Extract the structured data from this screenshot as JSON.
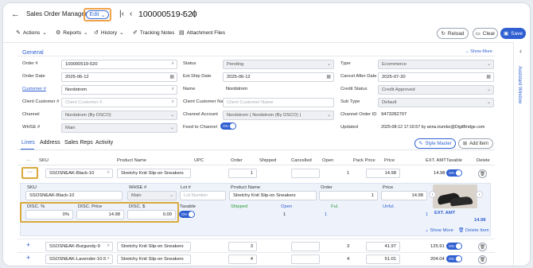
{
  "header": {
    "title": "Sales Order Management",
    "edit_label": "Edit",
    "order_number": "100000519-520"
  },
  "toolbar": {
    "actions": "Actions",
    "reports": "Reports",
    "history": "History",
    "tracking_notes": "Tracking Notes",
    "attachment_files": "Attachment Files",
    "reload": "Reload",
    "clear": "Clear",
    "save": "Save"
  },
  "side_rail": {
    "label": "Assistant Window"
  },
  "general": {
    "title": "General",
    "show_more": "Show More",
    "order_no_label": "Order #",
    "order_no": "100000519-520",
    "order_date_label": "Order Date",
    "order_date": "2025-06-12",
    "customer_label": "Customer #",
    "customer": "Nordstrom",
    "client_customer_label": "Client Customer #",
    "client_customer_ph": "Client Customer #",
    "channel_label": "Channel",
    "channel": "Nordstrom (By DSCO)",
    "whse_label": "WHSE #",
    "whse": "Main",
    "status_label": "Status",
    "status": "Pending",
    "est_ship_label": "Est.Ship Date",
    "est_ship": "2025-06-12",
    "name_label": "Name",
    "name": "Nordstrom",
    "client_customer_name_label": "Client Customer Name",
    "client_customer_name_ph": "Client Customer Name",
    "channel_account_label": "Channel Account",
    "channel_account": "Nordstrom ( Nordstrom (By DSCO) )",
    "feed_label": "Feed to Channel",
    "feed_toggle": "ON",
    "type_label": "Type",
    "type": "Ecommerce",
    "cancel_after_label": "Cancel After Date",
    "cancel_after": "2025-07-20",
    "credit_status_label": "Credit Status",
    "credit_status": "Credit Approved",
    "sub_type_label": "Sub Type",
    "sub_type": "Default",
    "channel_order_label": "Channel Order ID",
    "channel_order": "9473282707",
    "updated_label": "Updated",
    "updated": "2025-08-12 17:16:57 by anna.trumbo@DigitBridge.com"
  },
  "tabs": [
    "Lines",
    "Address",
    "Sales Reps",
    "Activity"
  ],
  "lines_actions": {
    "style_master": "Style Master",
    "add_item": "Add Item"
  },
  "table": {
    "headers": [
      "SKU",
      "Product Name",
      "UPC",
      "Order",
      "Shipped",
      "Cancelled",
      "Open",
      "Pack Price",
      "Price",
      "EXT. AMT",
      "Taxable",
      "Delete"
    ],
    "rows": [
      {
        "sku": "SSOSNEAK-Black-10",
        "name": "Stretchy Knit Slip-on Sneakers",
        "order": "1",
        "open": "1",
        "price": "14.98",
        "ext": "14.98",
        "taxable": "ON"
      },
      {
        "sku": "SSOSNEAK-Burgundy-9",
        "name": "Stretchy Knit Slip-on Sneakers",
        "order": "3",
        "open": "3",
        "price": "41.97",
        "ext": "125.91",
        "taxable": "ON"
      },
      {
        "sku": "SSOSNEAK-Lavender-10.5",
        "name": "Stretchy Knit Slip-on Sneakers",
        "order": "4",
        "open": "4",
        "price": "51.01",
        "ext": "204.04",
        "taxable": "ON"
      }
    ]
  },
  "detail": {
    "more_icon": "···",
    "sku_label": "SKU",
    "sku": "SSOSNEAK-Black-10",
    "whse_label": "WHSE #",
    "whse": "Main",
    "lot_label": "Lot #",
    "lot_ph": "Lot Number",
    "product_label": "Product Name",
    "product": "Stretchy Knit Slip-on Sneakers",
    "order_label": "Order",
    "order": "1",
    "price_label": "Price",
    "price": "14.98",
    "disc_pct_label": "DISC. %",
    "disc_pct": "0%",
    "disc_price_label": "DISC. Price",
    "disc_price": "14.98",
    "disc_amt_label": "DISC. $",
    "disc_amt": "0.00",
    "taxable_label": "Taxable",
    "taxable": "ON",
    "shipped_label": "Shipped",
    "open_label": "Open",
    "ful_label": "Ful.",
    "unful_label": "Unful.",
    "open_value": "1",
    "unful_value": "1",
    "ext_amt_label": "EXT. AMT",
    "ext_amt": "14.98",
    "show_more": "Show More",
    "delete_item": "Delete Item"
  }
}
